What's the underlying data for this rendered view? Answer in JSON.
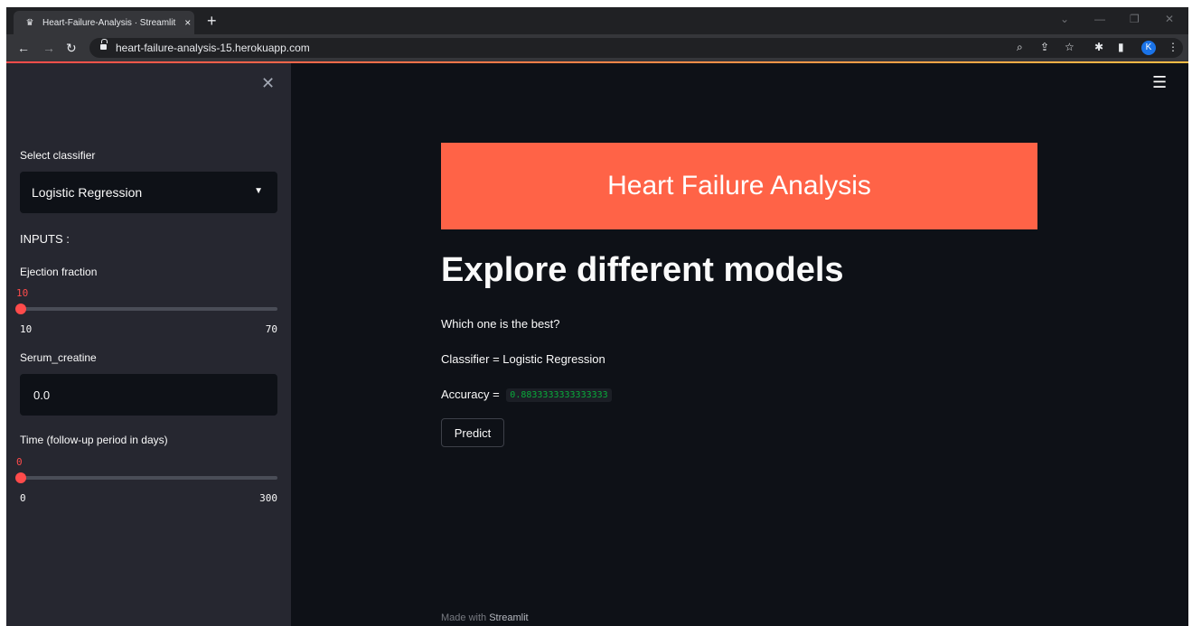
{
  "browser": {
    "tab_title": "Heart-Failure-Analysis · Streamlit",
    "tab_close": "×",
    "new_tab": "+",
    "url": "heart-failure-analysis-15.herokuapp.com",
    "profile_initial": "K",
    "icons": {
      "back": "back-arrow-icon",
      "forward": "forward-arrow-icon",
      "reload": "reload-icon",
      "zoom": "zoom-icon",
      "share": "share-icon",
      "bookmark": "star-icon",
      "extensions": "puzzle-icon",
      "sidepanel": "side-panel-icon",
      "menu": "kebab-menu-icon"
    }
  },
  "sidebar": {
    "classifier_label": "Select classifier",
    "classifier_value": "Logistic Regression",
    "inputs_heading": "INPUTS :",
    "ejection": {
      "label": "Ejection fraction",
      "current": "10",
      "min": "10",
      "max": "70",
      "fraction": 0.0
    },
    "serum": {
      "label": "Serum_creatine",
      "value": "0.0"
    },
    "time": {
      "label": "Time (follow-up period in days)",
      "current": "0",
      "min": "0",
      "max": "300",
      "fraction": 0.0
    }
  },
  "main": {
    "banner_title": "Heart Failure Analysis",
    "heading": "Explore different models",
    "subtitle": "Which one is the best?",
    "classifier_text": "Classifier = Logistic Regression",
    "accuracy_label": "Accuracy =",
    "accuracy_value": "0.8833333333333333",
    "predict_label": "Predict",
    "footer_prefix": "Made with",
    "footer_brand": "Streamlit"
  },
  "colors": {
    "banner": "#ff6347",
    "accent": "#ff4b4b",
    "background": "#0e1117",
    "sidebar": "#262730",
    "code_text": "#09ab3b"
  }
}
